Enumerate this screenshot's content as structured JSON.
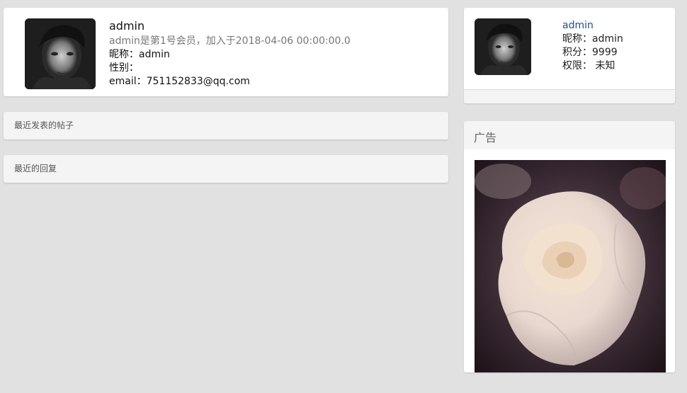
{
  "profile": {
    "avatar_icon": "user-avatar-photo",
    "name": "admin",
    "description": "admin是第1号会员，加入于2018-04-06 00:00:00.0",
    "nickname_line": "昵称：admin",
    "gender_line": "性别：",
    "email_line": "email：751152833@qq.com"
  },
  "sections": {
    "recent_posts": "最近发表的帖子",
    "recent_replies": "最近的回复"
  },
  "user_card": {
    "avatar_icon": "user-avatar-photo",
    "username": "admin",
    "nickname_line": "昵称：admin",
    "points_line": "积分：9999",
    "permission_line": "权限： 未知"
  },
  "ad": {
    "title": "广告",
    "image_icon": "white-rose-photo"
  },
  "colors": {
    "background": "#e1e1e1",
    "link": "#1c4f9c",
    "muted_text": "#777777"
  }
}
